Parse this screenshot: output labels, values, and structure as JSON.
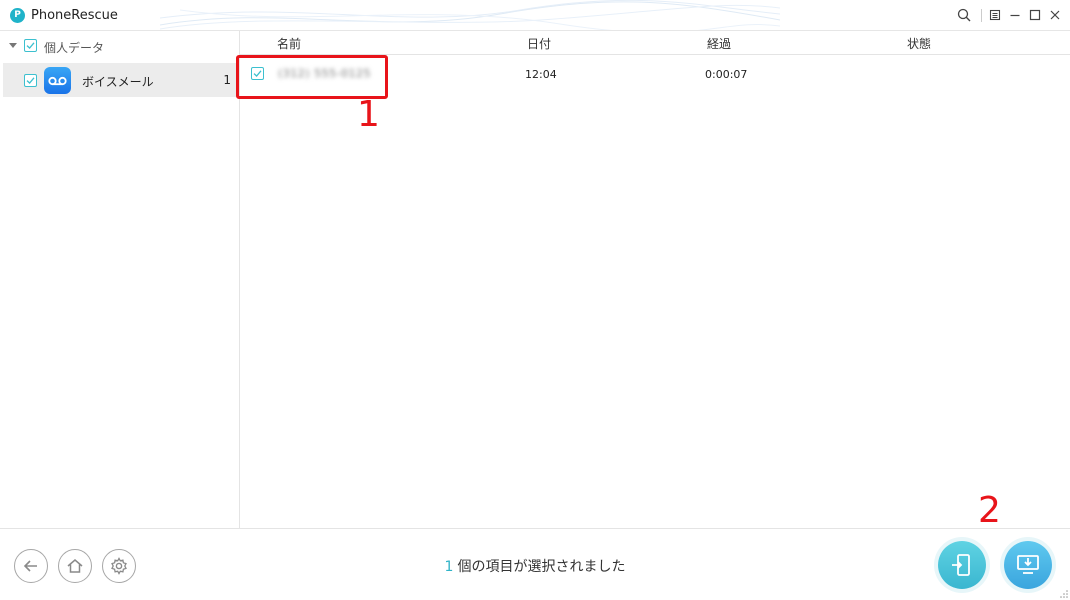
{
  "app": {
    "title": "PhoneRescue",
    "logo_glyph": "P"
  },
  "titlebar": {
    "icons": [
      "search-icon",
      "menu-icon",
      "minimize-icon",
      "maximize-icon",
      "close-icon"
    ]
  },
  "sidebar": {
    "category": {
      "label": "個人データ",
      "checked": true,
      "expanded": true
    },
    "items": [
      {
        "label": "ボイスメール",
        "count": "1",
        "checked": true,
        "icon": "voicemail-icon"
      }
    ]
  },
  "table": {
    "columns": [
      "名前",
      "日付",
      "経過",
      "状態"
    ],
    "rows": [
      {
        "name": "(312) 555-0125",
        "date": "12:04",
        "duration": "0:00:07",
        "status": "",
        "checked": true
      }
    ]
  },
  "annotations": [
    {
      "label": "1"
    },
    {
      "label": "2"
    }
  ],
  "footer": {
    "selected_count": "1",
    "selected_text": "個の項目が選択されました",
    "nav_icons": [
      "back-icon",
      "home-icon",
      "settings-icon"
    ],
    "actions": [
      "to-device-icon",
      "to-computer-icon"
    ]
  },
  "colors": {
    "accent": "#2fb3c7",
    "annotation": "#e8141a",
    "selected_row": "#ececec"
  }
}
